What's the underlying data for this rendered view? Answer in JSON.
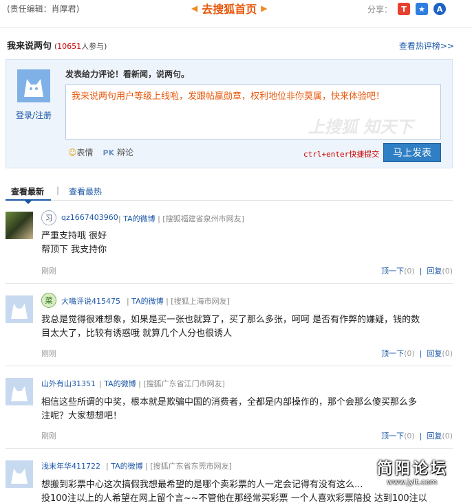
{
  "topbar": {
    "editor": "(责任编辑：肖厚君)",
    "home_link": "去搜狐首页",
    "share_label": "分享：",
    "share_icons": [
      "T",
      "★",
      "A"
    ]
  },
  "comments_head": {
    "title": "我来说两句",
    "count_prefix": "(",
    "count": "10651",
    "count_suffix": "人参与)",
    "hot_link": "查看热评榜>>"
  },
  "post": {
    "login": "登录/注册",
    "prompt": "发表给力评论！看新闻，说两句。",
    "placeholder": "我来说两句用户等级上线啦，发跟帖赢勋章，权利地位非你莫属，快来体验吧！",
    "watermark": "上搜狐 知天下",
    "emoji": "表情",
    "pk": "辩论",
    "hint": "ctrl+enter快捷提交",
    "submit": "马上发表"
  },
  "tabs": {
    "newest": "查看最新",
    "sep": "|",
    "hottest": "查看最热"
  },
  "comments": [
    {
      "badge": "习",
      "user": "qz1667403960",
      "weibo": "TA的微博",
      "location": "[搜狐福建省泉州市网友]",
      "text_lines": [
        "严重支持哦  很好",
        "帮顶下  我支持你"
      ],
      "time": "刚刚",
      "up": "顶一下",
      "up_count": "(0)",
      "reply": "回复",
      "reply_count": "(0)"
    },
    {
      "badge": "菜",
      "user": "大嘴评说415475",
      "weibo": "TA的微博",
      "location": "[搜狐上海市网友]",
      "text_lines": [
        "我总是觉得很难想象，如果是买一张也就算了，买了那么多张，呵呵  是否有作弊的嫌疑，钱的数",
        "目太大了，比较有诱惑哦  就算几个人分也很诱人"
      ],
      "time": "刚刚",
      "up": "顶一下",
      "up_count": "(0)",
      "reply": "回复",
      "reply_count": "(0)"
    },
    {
      "badge": "",
      "user": "山外有山31351",
      "weibo": "TA的微博",
      "location": "[搜狐广东省江门市网友]",
      "text_lines": [
        "相信这些所谓的中奖，根本就是欺骗中国的消费者，全都是内部操作的，那个会那么傻买那么多",
        "注呢？大家想想吧！"
      ],
      "time": "刚刚",
      "up": "顶一下",
      "up_count": "(0)",
      "reply": "回复",
      "reply_count": "(0)"
    },
    {
      "badge": "",
      "user": "浅末年华411722",
      "weibo": "TA的微博",
      "location": "[搜狐广东省东莞市网友]",
      "text_lines": [
        "想搬到彩票中心这次搞假我想最希望的是哪个卖彩票的人一定会记得有没有这么...",
        "投100注以上的人希望在网上留个言~~不管他在那经常买彩票  一个人喜欢彩票陪投  达到100注以"
      ],
      "time": "",
      "up": "",
      "up_count": "",
      "reply": "",
      "reply_count": ""
    }
  ],
  "forum_mark": {
    "name": "简阳论坛",
    "url": "www.jylt.com"
  }
}
